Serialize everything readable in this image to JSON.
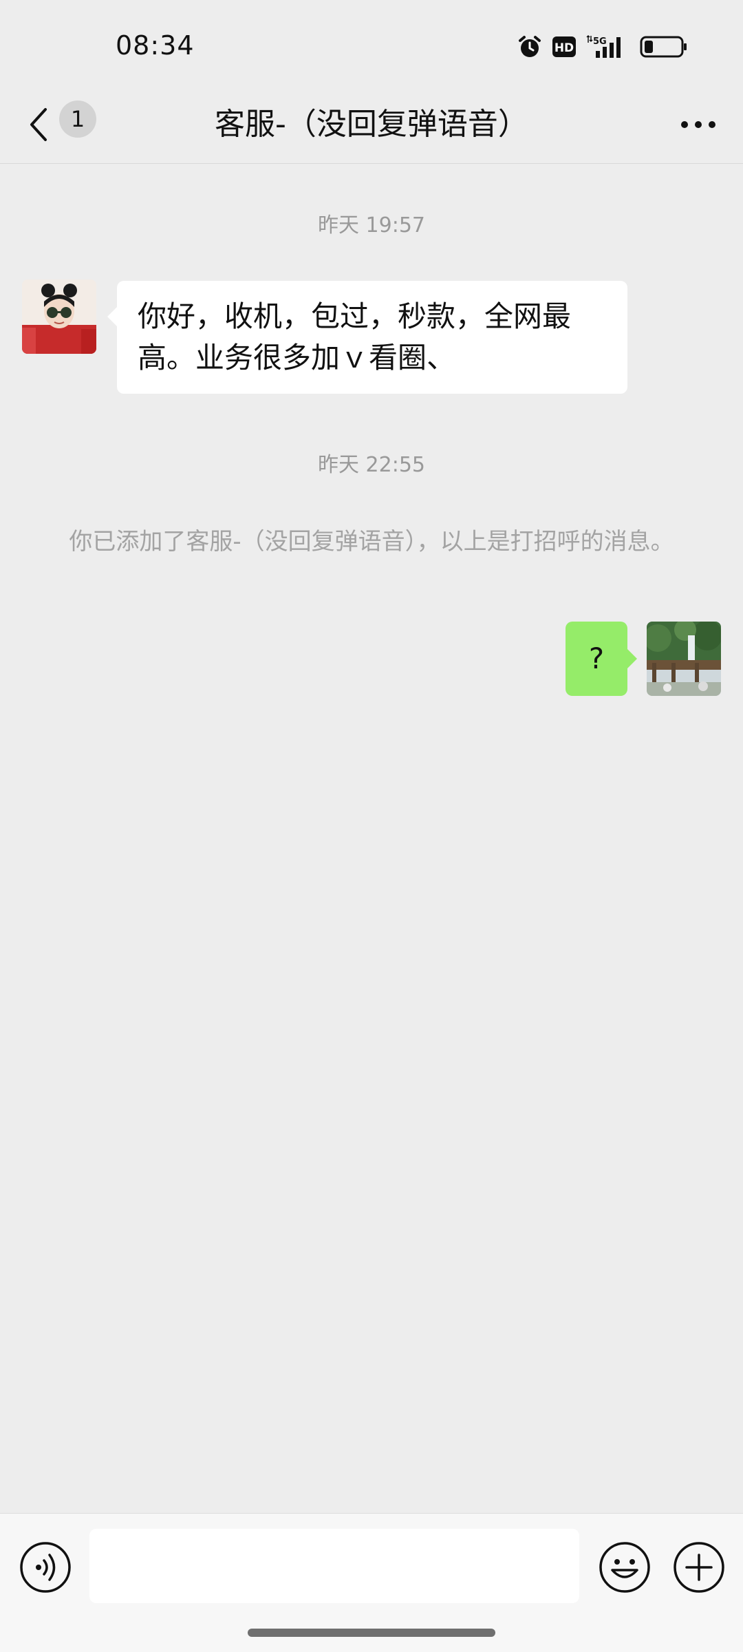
{
  "status_bar": {
    "time": "08:34",
    "icons": [
      "alarm-icon",
      "hd-icon",
      "signal-5g-icon",
      "battery-icon"
    ],
    "hd_label": "HD",
    "network_label": "5G"
  },
  "header": {
    "unread_count": "1",
    "title": "客服-（没回复弹语音）",
    "back_icon": "chevron-left-icon",
    "more_icon": "more-dots-icon"
  },
  "messages": [
    {
      "type": "timestamp",
      "text": "昨天 19:57"
    },
    {
      "type": "incoming",
      "text": "你好，收机，包过，秒款，全网最高。业务很多加ｖ看圈、"
    },
    {
      "type": "timestamp",
      "text": "昨天 22:55"
    },
    {
      "type": "system",
      "text": "你已添加了客服-（没回复弹语音），以上是打招呼的消息。"
    },
    {
      "type": "outgoing",
      "text": "?"
    }
  ],
  "input_bar": {
    "placeholder": "",
    "voice_icon": "voice-icon",
    "emoji_icon": "emoji-icon",
    "plus_icon": "plus-icon"
  },
  "colors": {
    "background": "#ededed",
    "outgoing_bubble": "#95ec69",
    "incoming_bubble": "#ffffff",
    "meta_text": "#999999"
  }
}
